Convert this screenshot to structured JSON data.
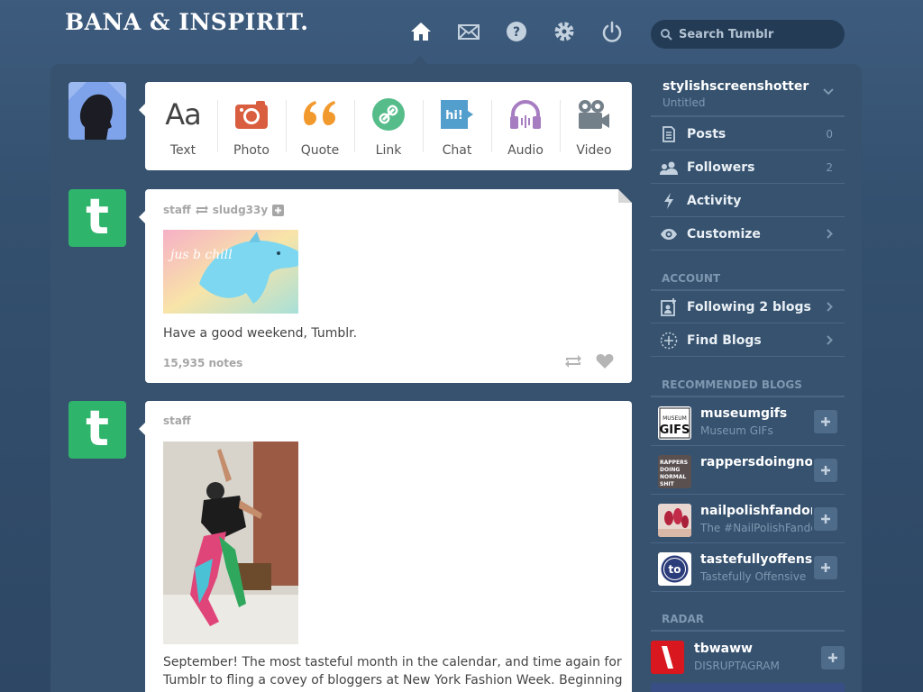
{
  "header": {
    "logo": "BANA & INSPIRIT.",
    "nav": [
      {
        "icon": "home-icon"
      },
      {
        "icon": "mail-icon"
      },
      {
        "icon": "help-icon"
      },
      {
        "icon": "gear-icon"
      },
      {
        "icon": "power-icon"
      }
    ],
    "search_placeholder": "Search Tumblr"
  },
  "composer": {
    "types": [
      {
        "label": "Text",
        "glyph": "Aa",
        "color": "#444444"
      },
      {
        "label": "Photo",
        "color": "#d95e40"
      },
      {
        "label": "Quote",
        "glyph": "66",
        "color": "#f2992e"
      },
      {
        "label": "Link",
        "color": "#56bc8a"
      },
      {
        "label": "Chat",
        "glyph": "hi!",
        "color": "#529ecc"
      },
      {
        "label": "Audio",
        "color": "#a77dc2"
      },
      {
        "label": "Video",
        "color": "#748089"
      }
    ]
  },
  "posts": [
    {
      "author": "staff",
      "reblogged_from": "sludg33y",
      "image_text": "jus b chill",
      "text": "Have a good weekend, Tumblr.",
      "notes": "15,935 notes"
    },
    {
      "author": "staff",
      "text_lines": [
        "September! The most tasteful month in the calendar, and time again for",
        "Tumblr to fling a covey of bloggers at New York Fashion Week. Beginning"
      ]
    }
  ],
  "sidebar": {
    "blog": {
      "name": "stylishscreenshotter",
      "subtitle": "Untitled"
    },
    "items": [
      {
        "label": "Posts",
        "count": "0",
        "icon": "posts-icon"
      },
      {
        "label": "Followers",
        "count": "2",
        "icon": "followers-icon"
      },
      {
        "label": "Activity",
        "icon": "activity-icon"
      },
      {
        "label": "Customize",
        "icon": "eye-icon"
      }
    ],
    "account_title": "ACCOUNT",
    "account_items": [
      {
        "label": "Following 2 blogs",
        "icon": "following-icon"
      },
      {
        "label": "Find Blogs",
        "icon": "find-blogs-icon"
      }
    ],
    "recommended_title": "RECOMMENDED BLOGS",
    "recommended": [
      {
        "name": "museumgifs",
        "subtitle": "Museum GIFs",
        "thumb_text": "MUSEUM GIFS"
      },
      {
        "name": "rappersdoingnormalshit",
        "subtitle": "",
        "thumb_text": "RAPPERS DOING NORMAL SHIT"
      },
      {
        "name": "nailpolishfandom",
        "subtitle": "The #NailPolishFandom"
      },
      {
        "name": "tastefullyoffensive",
        "subtitle": "Tastefully Offensive",
        "thumb_text": "to"
      }
    ],
    "radar_title": "RADAR",
    "radar": {
      "name": "tbwaww",
      "subtitle": "DISRUPTAGRAM"
    }
  },
  "colors": {
    "background": "#2f4a68",
    "panel": "#36526f",
    "tumblr_green": "#2fb46b"
  }
}
